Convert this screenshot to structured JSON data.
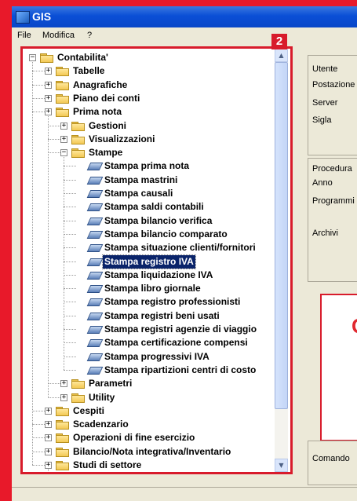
{
  "window": {
    "title": "GIS"
  },
  "menu": [
    {
      "label": "File",
      "accel": "F"
    },
    {
      "label": "Modifica",
      "accel": "M"
    },
    {
      "label": "?",
      "accel": ""
    }
  ],
  "badge": "2",
  "tree": [
    {
      "label": "Contabilita'",
      "level": 0,
      "toggle": "minus",
      "icon": "folder"
    },
    {
      "label": "Tabelle",
      "level": 1,
      "toggle": "plus",
      "icon": "folder"
    },
    {
      "label": "Anagrafiche",
      "level": 1,
      "toggle": "plus",
      "icon": "folder"
    },
    {
      "label": "Piano dei conti",
      "level": 1,
      "toggle": "plus",
      "icon": "folder"
    },
    {
      "label": "Prima nota",
      "level": 1,
      "toggle": "plus",
      "icon": "folder"
    },
    {
      "label": "Gestioni",
      "level": 2,
      "toggle": "plus",
      "icon": "folder"
    },
    {
      "label": "Visualizzazioni",
      "level": 2,
      "toggle": "plus",
      "icon": "folder"
    },
    {
      "label": "Stampe",
      "level": 2,
      "toggle": "minus",
      "icon": "folder"
    },
    {
      "label": "Stampa prima nota",
      "level": 3,
      "toggle": "",
      "icon": "doc"
    },
    {
      "label": "Stampa mastrini",
      "level": 3,
      "toggle": "",
      "icon": "doc"
    },
    {
      "label": "Stampa causali",
      "level": 3,
      "toggle": "",
      "icon": "doc"
    },
    {
      "label": "Stampa saldi contabili",
      "level": 3,
      "toggle": "",
      "icon": "doc"
    },
    {
      "label": "Stampa bilancio verifica",
      "level": 3,
      "toggle": "",
      "icon": "doc"
    },
    {
      "label": "Stampa bilancio comparato",
      "level": 3,
      "toggle": "",
      "icon": "doc"
    },
    {
      "label": "Stampa situazione clienti/fornitori",
      "level": 3,
      "toggle": "",
      "icon": "doc"
    },
    {
      "label": "Stampa registro IVA",
      "level": 3,
      "toggle": "",
      "icon": "doc",
      "selected": true
    },
    {
      "label": "Stampa liquidazione IVA",
      "level": 3,
      "toggle": "",
      "icon": "doc"
    },
    {
      "label": "Stampa libro giornale",
      "level": 3,
      "toggle": "",
      "icon": "doc"
    },
    {
      "label": "Stampa registro professionisti",
      "level": 3,
      "toggle": "",
      "icon": "doc"
    },
    {
      "label": "Stampa registri beni usati",
      "level": 3,
      "toggle": "",
      "icon": "doc"
    },
    {
      "label": "Stampa registri agenzie di viaggio",
      "level": 3,
      "toggle": "",
      "icon": "doc"
    },
    {
      "label": "Stampa certificazione compensi",
      "level": 3,
      "toggle": "",
      "icon": "doc"
    },
    {
      "label": "Stampa progressivi IVA",
      "level": 3,
      "toggle": "",
      "icon": "doc"
    },
    {
      "label": "Stampa ripartizioni centri di costo",
      "level": 3,
      "toggle": "",
      "icon": "doc"
    },
    {
      "label": "Parametri",
      "level": 2,
      "toggle": "plus",
      "icon": "folder"
    },
    {
      "label": "Utility",
      "level": 2,
      "toggle": "plus",
      "icon": "folder"
    },
    {
      "label": "Cespiti",
      "level": 1,
      "toggle": "plus",
      "icon": "folder"
    },
    {
      "label": "Scadenzario",
      "level": 1,
      "toggle": "plus",
      "icon": "folder"
    },
    {
      "label": "Operazioni di fine esercizio",
      "level": 1,
      "toggle": "plus",
      "icon": "folder"
    },
    {
      "label": "Bilancio/Nota integrativa/Inventario",
      "level": 1,
      "toggle": "plus",
      "icon": "folder"
    },
    {
      "label": "Studi di settore",
      "level": 1,
      "toggle": "plus",
      "icon": "folder"
    }
  ],
  "info_panel": {
    "group1": [
      "Utente",
      "Postazione",
      "Server",
      "Sigla"
    ],
    "group2": [
      "Procedura",
      "Anno",
      "Programmi",
      "Archivi"
    ],
    "logo_text": "G",
    "command_label": "Comando"
  },
  "colors": {
    "frame_red": "#e8192a",
    "selection": "#0a246a",
    "title_blue": "#0a4fd6"
  }
}
